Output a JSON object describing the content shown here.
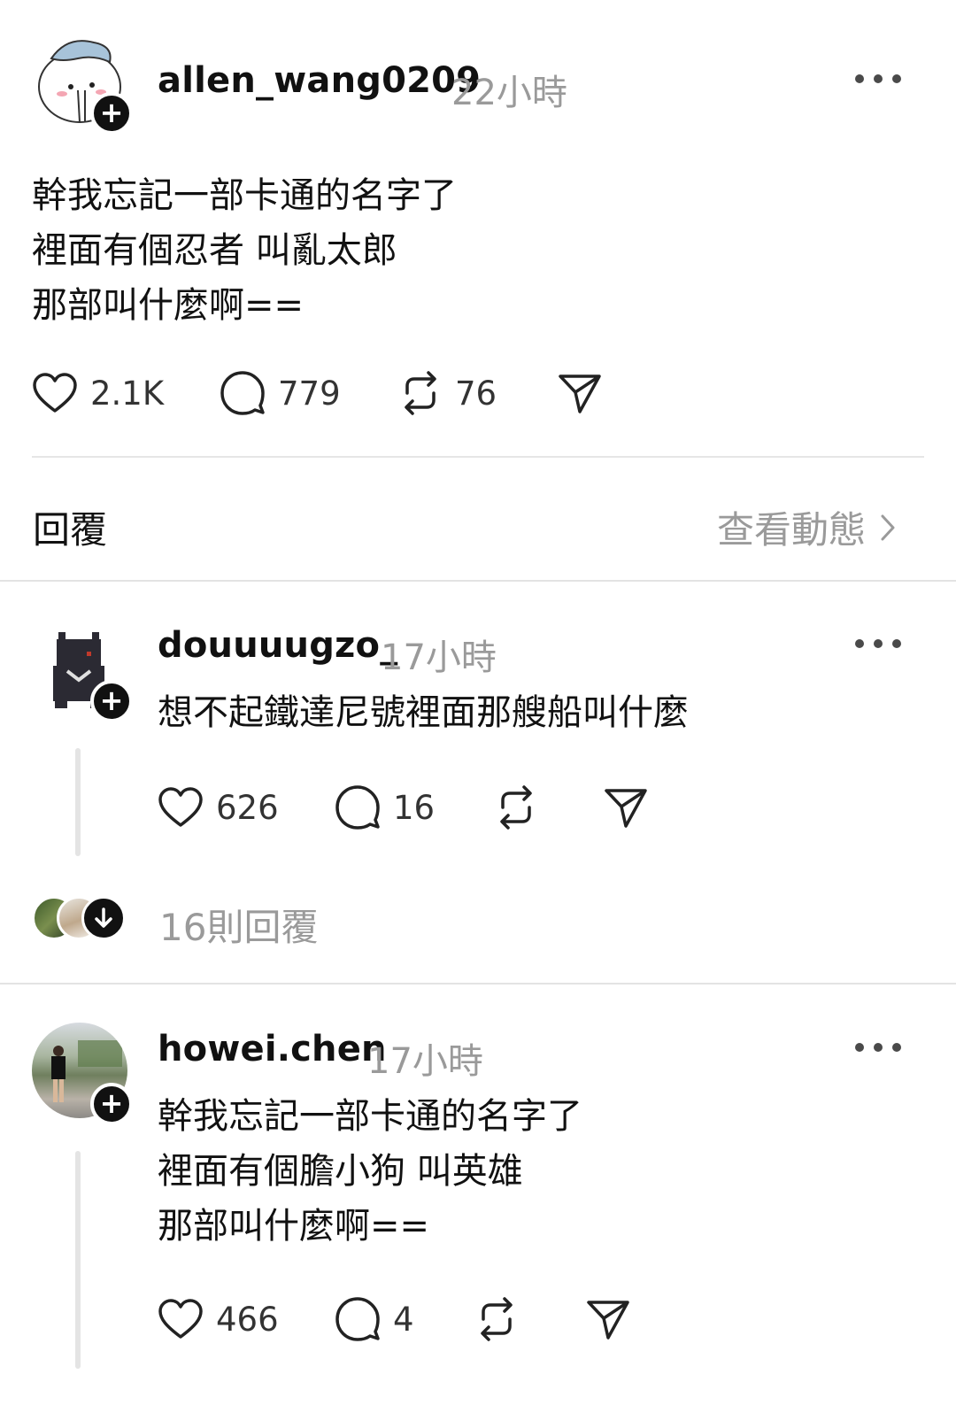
{
  "post": {
    "username": "allen_wang0209",
    "time": "22小時",
    "lines": [
      "幹我忘記一部卡通的名字了",
      "裡面有個忍者 叫亂太郎",
      "那部叫什麼啊=="
    ],
    "likes": "2.1K",
    "comments": "779",
    "reposts": "76"
  },
  "replies_bar": {
    "label": "回覆",
    "activity": "查看動態"
  },
  "reply1": {
    "username": "douuuugzo_",
    "time": "17小時",
    "lines": [
      "想不起鐵達尼號裡面那艘船叫什麼"
    ],
    "likes": "626",
    "comments": "16",
    "reply_count": "16則回覆"
  },
  "reply2": {
    "username": "howei.chen",
    "time": "17小時",
    "lines": [
      "幹我忘記一部卡通的名字了",
      "裡面有個膽小狗 叫英雄",
      "那部叫什麼啊=="
    ],
    "likes": "466",
    "comments": "4"
  },
  "colors": {
    "text": "#111111",
    "muted": "#9a9a9a",
    "divider": "#e3e3e3"
  },
  "icons": [
    "heart-icon",
    "comment-icon",
    "repost-icon",
    "share-icon",
    "more-icon",
    "plus-icon",
    "chevron-right-icon",
    "arrow-down-icon"
  ]
}
